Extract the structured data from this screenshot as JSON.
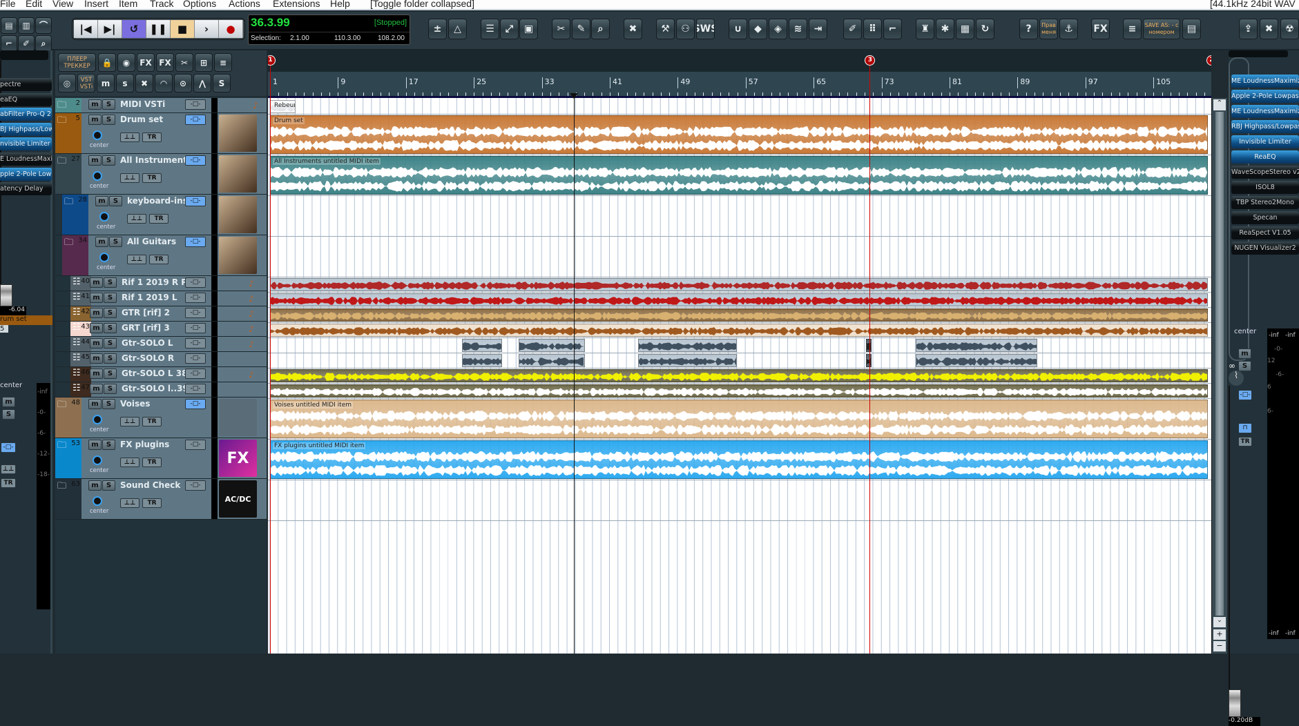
{
  "menu": [
    "File",
    "Edit",
    "View",
    "Insert",
    "Item",
    "Track",
    "Options",
    "Actions",
    "Extensions",
    "Help"
  ],
  "status_left": "[Toggle folder collapsed]",
  "status_right": "[44.1kHz 24bit WAV",
  "transport": {
    "buttons": [
      {
        "name": "go-to-start",
        "glyph": "|◀"
      },
      {
        "name": "go-to-end",
        "glyph": "▶|"
      },
      {
        "name": "repeat",
        "glyph": "↺",
        "active": true,
        "color": "#7b6fe0"
      },
      {
        "name": "pause",
        "glyph": "❚❚"
      },
      {
        "name": "stop",
        "glyph": "■",
        "color": "#f0d29a"
      },
      {
        "name": "play",
        "glyph": "›"
      },
      {
        "name": "record",
        "glyph": "●",
        "color_glyph": "#c00000"
      }
    ],
    "time": "36.3.99",
    "state": "[Stopped]",
    "selection_label": "Selection:",
    "sel_start": "2.1.00",
    "sel_end": "110.3.00",
    "sel_length": "108.2.00"
  },
  "toolbar": [
    {
      "icon": "tempo-icon",
      "glyph": "±"
    },
    {
      "icon": "metronome-icon",
      "glyph": "△"
    },
    {
      "icon": "mixer-visibility-icon",
      "glyph": "☰"
    },
    {
      "icon": "fullscreen-icon",
      "glyph": "⤢"
    },
    {
      "icon": "screenshot-icon",
      "glyph": "▣"
    },
    {
      "icon": "scissors-icon",
      "glyph": "✂"
    },
    {
      "icon": "pencil-icon",
      "glyph": "✎"
    },
    {
      "icon": "zoom-icon",
      "glyph": "⌕"
    },
    {
      "icon": "remove-tracks-icon",
      "glyph": "✖"
    },
    {
      "icon": "wrench-icon",
      "glyph": "⚒"
    },
    {
      "icon": "walkers-icon",
      "glyph": "⚇"
    },
    {
      "icon": "sws-icon",
      "glyph": "SWS"
    },
    {
      "icon": "snap-magnet-icon",
      "glyph": "∪"
    },
    {
      "icon": "ripple-icon",
      "glyph": "◆"
    },
    {
      "icon": "grid-green-icon",
      "glyph": "◈"
    },
    {
      "icon": "envelope-lock-icon",
      "glyph": "≋"
    },
    {
      "icon": "transient-icon",
      "glyph": "⇥"
    },
    {
      "icon": "color-brush-icon",
      "glyph": "✐"
    },
    {
      "icon": "grid-dots-icon",
      "glyph": "⠿"
    },
    {
      "icon": "marker-flag-icon",
      "glyph": "⌐"
    },
    {
      "icon": "clean-brush-icon",
      "glyph": "♜"
    },
    {
      "icon": "new-project-icon",
      "glyph": "✱"
    },
    {
      "icon": "table-icon",
      "glyph": "▦"
    },
    {
      "icon": "undo-disk-icon",
      "glyph": "↻"
    },
    {
      "icon": "help-icon",
      "glyph": "?"
    },
    {
      "icon": "prav-menya-button",
      "glyph": "Прав меня"
    },
    {
      "icon": "anchor-icon",
      "glyph": "⚓"
    },
    {
      "icon": "bypass-fx-icon",
      "glyph": "FX"
    },
    {
      "icon": "tracklist-icon",
      "glyph": "≡"
    },
    {
      "icon": "save-as-button",
      "glyph": "SAVE AS: - с номером"
    },
    {
      "icon": "midi-editor-icon",
      "glyph": "▤"
    },
    {
      "icon": "folder-export-icon",
      "glyph": "⇪"
    },
    {
      "icon": "folder-delete-icon",
      "glyph": "✖"
    },
    {
      "icon": "radiation-icon",
      "glyph": "☢"
    }
  ],
  "left_tools": [
    {
      "icon": "film-icon",
      "glyph": "▤"
    },
    {
      "icon": "color-spectrum-icon",
      "glyph": "▥"
    },
    {
      "icon": "curve-icon",
      "glyph": "⌒"
    },
    {
      "icon": "fade-icon",
      "glyph": "⌐"
    },
    {
      "icon": "paint-icon",
      "glyph": "✐"
    },
    {
      "icon": "find-doc-icon",
      "glyph": "⌕"
    }
  ],
  "tools2": [
    {
      "icon": "player-tracker-button",
      "glyph": "ПЛЕЕР ТРЕККЕР"
    },
    {
      "icon": "lock-icon",
      "glyph": "🔒"
    },
    {
      "icon": "show-mixer-icon",
      "glyph": "◉"
    },
    {
      "icon": "remove-fx-icon",
      "glyph": "FX"
    },
    {
      "icon": "show-fx-icon",
      "glyph": "FX"
    },
    {
      "icon": "split-icon",
      "glyph": "✂"
    },
    {
      "icon": "folder-routing-icon",
      "glyph": "⊞"
    },
    {
      "icon": "track-list-icon",
      "glyph": "≡"
    },
    {
      "icon": "vinyl-icon",
      "glyph": "◎"
    },
    {
      "icon": "vst-vsti-button",
      "glyph": "VST VSTi"
    },
    {
      "icon": "mute-all-icon",
      "glyph": "m"
    },
    {
      "icon": "solo-all-icon",
      "glyph": "s"
    },
    {
      "icon": "remove-envelope-icon",
      "glyph": "✖"
    },
    {
      "icon": "show-envelope-icon",
      "glyph": "◠"
    },
    {
      "icon": "record-arm-list-icon",
      "glyph": "⊙"
    },
    {
      "icon": "envelope-copy-icon",
      "glyph": "⋀"
    },
    {
      "icon": "unsolo-icon",
      "glyph": "S"
    }
  ],
  "left_fx": [
    {
      "name": "pectre",
      "on": false
    },
    {
      "name": "eaEQ",
      "on": false
    },
    {
      "name": "abFilter Pro-Q 2",
      "on": true
    },
    {
      "name": "BJ Highpass/Low",
      "on": true
    },
    {
      "name": "nvisible Limiter",
      "on": true
    },
    {
      "name": "E LoudnessMaxim",
      "on": false
    },
    {
      "name": "pple 2-Pole Lowpa",
      "on": true
    },
    {
      "name": "atency Delay",
      "on": false
    }
  ],
  "left_mixer": {
    "pan": "center",
    "mute": "m",
    "solo": "S",
    "phase": "⊥⊥",
    "trim": "TR",
    "scale": [
      "-inf",
      "-0-",
      "-6-",
      "-12-",
      "-18-"
    ],
    "volume": "-6.04",
    "track_name": "rum set",
    "track_num": "5",
    "color": "#9a5a10"
  },
  "right_fx": [
    {
      "name": "ME LoudnessMaximizer",
      "on": true
    },
    {
      "name": "Apple 2-Pole Lowpass F",
      "on": true
    },
    {
      "name": "ME LoudnessMaximizer",
      "on": true
    },
    {
      "name": "RBJ Highpass/Lowpass",
      "on": true
    },
    {
      "name": "Invisible Limiter",
      "on": true
    },
    {
      "name": "ReaEQ",
      "on": true
    },
    {
      "name": "WaveScopeStereo v2",
      "on": false
    },
    {
      "name": "ISOL8",
      "on": false
    },
    {
      "name": "TBP Stereo2Mono",
      "on": false
    },
    {
      "name": "Specan",
      "on": false
    },
    {
      "name": "ReaSpect V1.05",
      "on": false
    },
    {
      "name": "NUGEN Visualizer2",
      "on": false
    }
  ],
  "right_mixer": {
    "pan": "center",
    "mute": "m",
    "solo": "S",
    "link": "∞",
    "trim": "TR",
    "peak_l": "-inf",
    "peak_r": "-inf",
    "scale": [
      "-0-",
      "12",
      "-6-",
      "6",
      "6-"
    ],
    "bottom_l": "-inf",
    "bottom_r": "-inf",
    "volume": "-0.20dB"
  },
  "track_controls": {
    "mute": "m",
    "solo": "S",
    "pan": "center",
    "phase": "⊥⊥",
    "trim": "TR",
    "route": "-□-"
  },
  "tracks": [
    {
      "num": "2",
      "name": "MIDI VSTi",
      "color": "#4e8c8c",
      "depth": 0,
      "kind": "folder",
      "tall": false,
      "route_on": false,
      "thumb": "folder-icon"
    },
    {
      "num": "5",
      "name": "Drum set",
      "color": "#9a5a10",
      "depth": 0,
      "kind": "folder",
      "tall": true,
      "route_on": true,
      "thumb": "drum-kit-image"
    },
    {
      "num": "27",
      "name": "All Instruments",
      "color": "#34464e",
      "depth": 0,
      "kind": "folder-open",
      "tall": true,
      "route_on": true,
      "thumb": "instruments-image"
    },
    {
      "num": "28",
      "name": "keyboard-instr",
      "color": "#0d4a8a",
      "depth": 1,
      "kind": "folder",
      "tall": true,
      "route_on": true,
      "thumb": "keyboard-image"
    },
    {
      "num": "34",
      "name": "All Guitars",
      "color": "#562a4c",
      "depth": 1,
      "kind": "folder-open",
      "tall": true,
      "route_on": true,
      "thumb": "guitars-image"
    },
    {
      "num": "40",
      "name": "Rif 1 2019 R Pit",
      "color": "#53616a",
      "depth": 2,
      "kind": "midi",
      "tall": false,
      "route_on": false,
      "thumb": "guitar-icon"
    },
    {
      "num": "41",
      "name": "Rif 1 2019 L",
      "color": "#53616a",
      "depth": 2,
      "kind": "midi",
      "tall": false,
      "route_on": false,
      "thumb": "red-guitar-icon"
    },
    {
      "num": "42",
      "name": "GTR [rif]  2",
      "color": "#8a6430",
      "depth": 2,
      "kind": "midi",
      "tall": false,
      "route_on": false,
      "thumb": "guitar-icon"
    },
    {
      "num": "43",
      "name": "GRT [rif]  3",
      "color": "#f5d8d0",
      "depth": 2,
      "kind": "midi",
      "tall": false,
      "route_on": false,
      "thumb": "guitar-icon"
    },
    {
      "num": "44",
      "name": "Gtr-SOLO  L",
      "color": "#53616a",
      "depth": 2,
      "kind": "midi",
      "tall": false,
      "route_on": false,
      "thumb": "guitar-icon"
    },
    {
      "num": "45",
      "name": "Gtr-SOLO  R",
      "color": "#53616a",
      "depth": 2,
      "kind": "midi",
      "tall": false,
      "route_on": false,
      "thumb": ""
    },
    {
      "num": "46",
      "name": "Gtr-SOLO  L 38",
      "color": "#3e2a1e",
      "depth": 2,
      "kind": "midi",
      "tall": false,
      "route_on": false,
      "thumb": "guitar-icon"
    },
    {
      "num": "47",
      "name": "Gtr-SOLO  l..39",
      "color": "#3e2a1e",
      "depth": 2,
      "kind": "midi",
      "tall": false,
      "route_on": false,
      "thumb": ""
    },
    {
      "num": "48",
      "name": "Voises",
      "color": "#8e7050",
      "depth": 0,
      "kind": "folder",
      "tall": true,
      "route_on": true,
      "thumb": "microphone-image"
    },
    {
      "num": "53",
      "name": "FX plugins",
      "color": "#0a88cc",
      "depth": 0,
      "kind": "folder",
      "tall": true,
      "route_on": false,
      "thumb": "festival-fx-image",
      "thumb_text": "FX"
    },
    {
      "num": "63",
      "name": "Sound Check",
      "color": "#22303a",
      "depth": 0,
      "kind": "folder",
      "tall": true,
      "route_on": false,
      "thumb": "acdc-image",
      "thumb_text": "AC/DC"
    }
  ],
  "ruler": {
    "labels": [
      "1",
      "9",
      "17",
      "25",
      "33",
      "41",
      "49",
      "57",
      "65",
      "73",
      "81",
      "89",
      "97",
      "105"
    ]
  },
  "markers": [
    {
      "id": "1",
      "bar": 1
    },
    {
      "id": "3",
      "bar": 71.6
    },
    {
      "id": "2",
      "bar": 111.8
    }
  ],
  "edit_cursor_bar": 36.75,
  "items": [
    {
      "track": 0,
      "start": 1,
      "end": 4,
      "color": "#f4f6f8",
      "wave": "#e0e4e8",
      "label": "Rebeur"
    },
    {
      "track": 1,
      "start": 1,
      "end": 111.4,
      "color": "#c97a38",
      "wave": "#ffffff",
      "label": "Drum set"
    },
    {
      "track": 2,
      "start": 1,
      "end": 111.4,
      "color": "#3e8488",
      "wave": "#ffffff",
      "label": "All Instruments untitled MIDI item"
    },
    {
      "track": 5,
      "start": 1,
      "end": 111.4,
      "color": "#b8c6d2",
      "wave": "#b02828"
    },
    {
      "track": 6,
      "start": 1,
      "end": 111.4,
      "color": "#b8c6d2",
      "wave": "#c01818"
    },
    {
      "track": 7,
      "start": 1,
      "end": 111.4,
      "color": "#8c6c42",
      "wave": "#d8b070"
    },
    {
      "track": 8,
      "start": 1,
      "end": 111.4,
      "color": "#f0e0cc",
      "wave": "#a05a20"
    },
    {
      "track": 9,
      "start": 23.6,
      "end": 28.3,
      "color": "#b6c4d0",
      "wave": "#40505e"
    },
    {
      "track": 9,
      "start": 30.3,
      "end": 38.1,
      "color": "#b6c4d0",
      "wave": "#40505e"
    },
    {
      "track": 9,
      "start": 44.3,
      "end": 56,
      "color": "#b6c4d0",
      "wave": "#40505e"
    },
    {
      "track": 9,
      "start": 71.2,
      "end": 71.8,
      "color": "#505c66",
      "wave": "#222"
    },
    {
      "track": 9,
      "start": 77,
      "end": 91.3,
      "color": "#b6c4d0",
      "wave": "#40505e"
    },
    {
      "track": 10,
      "start": 23.6,
      "end": 28.3,
      "color": "#b6c4d0",
      "wave": "#40505e"
    },
    {
      "track": 10,
      "start": 30.3,
      "end": 38.1,
      "color": "#b6c4d0",
      "wave": "#40505e"
    },
    {
      "track": 10,
      "start": 44.3,
      "end": 56,
      "color": "#b6c4d0",
      "wave": "#40505e"
    },
    {
      "track": 10,
      "start": 71.2,
      "end": 71.8,
      "color": "#505c66",
      "wave": "#222"
    },
    {
      "track": 10,
      "start": 77,
      "end": 91.3,
      "color": "#b6c4d0",
      "wave": "#40505e"
    },
    {
      "track": 11,
      "start": 1,
      "end": 111.4,
      "color": "#6e6a4a",
      "wave": "#f0f000"
    },
    {
      "track": 12,
      "start": 1,
      "end": 111.4,
      "color": "#6e6a4a",
      "wave": "#ffffff"
    },
    {
      "track": 13,
      "start": 1,
      "end": 111.4,
      "color": "#dcb88c",
      "wave": "#ffffff",
      "label": "Voises untitled MIDI item"
    },
    {
      "track": 14,
      "start": 1,
      "end": 111.4,
      "color": "#2eaaf0",
      "wave": "#ffffff",
      "label": "FX plugins untitled MIDI item"
    }
  ]
}
